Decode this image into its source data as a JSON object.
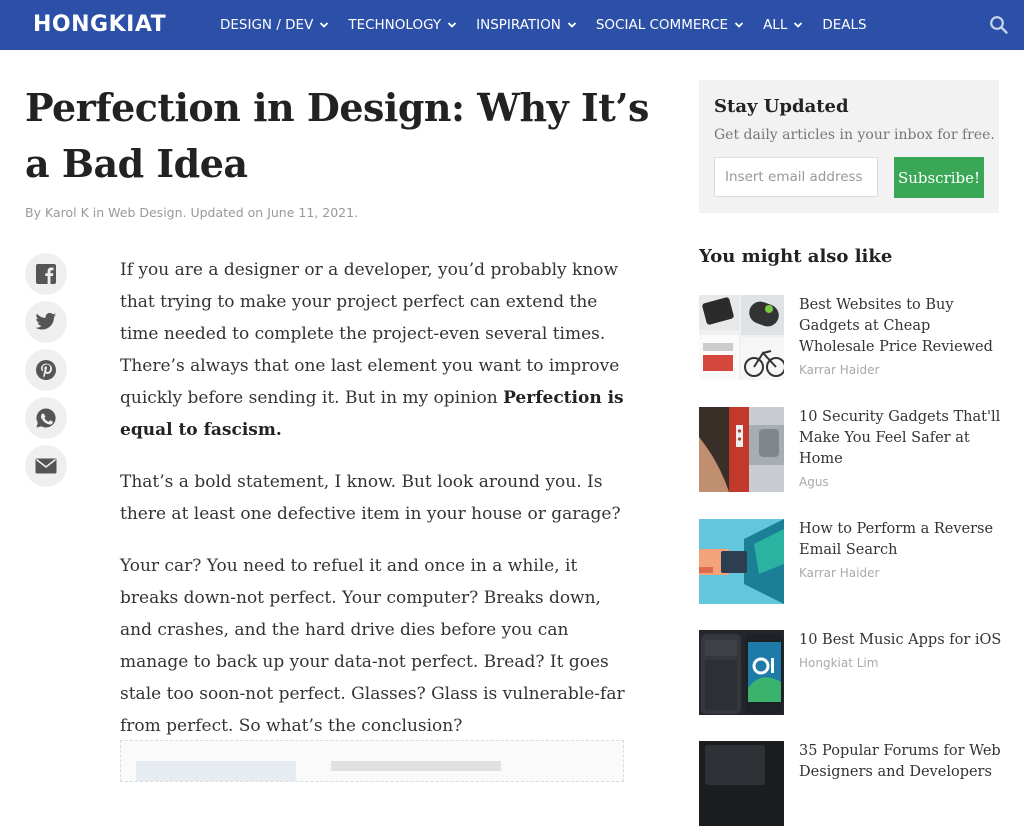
{
  "nav": {
    "logo": "HONGKIAT",
    "items": [
      {
        "label": "DESIGN / DEV",
        "has_dropdown": true
      },
      {
        "label": "TECHNOLOGY",
        "has_dropdown": true
      },
      {
        "label": "INSPIRATION",
        "has_dropdown": true
      },
      {
        "label": "SOCIAL COMMERCE",
        "has_dropdown": true
      },
      {
        "label": "ALL",
        "has_dropdown": true
      },
      {
        "label": "DEALS",
        "has_dropdown": false
      }
    ],
    "search_icon": "search-icon",
    "bg_color": "#2c4fa8"
  },
  "article": {
    "title": "Perfection in Design: Why It’s a Bad Idea",
    "meta": {
      "by": "By",
      "author": "Karol K",
      "in": "in",
      "category": "Web Design",
      "updated": ". Updated on June 11, 2021."
    },
    "share_icons": [
      "facebook-icon",
      "twitter-icon",
      "pinterest-icon",
      "whatsapp-icon",
      "email-icon"
    ],
    "paragraphs": [
      {
        "text": "If you are a designer or a developer, you’d probably know that trying to make your project perfect can extend the time needed to complete the project-even several times. There’s always that one last element you want to improve quickly before sending it. But in my opinion ",
        "bold": "Perfection is equal to fascism."
      },
      {
        "text": "That’s a bold statement, I know. But look around you. Is there at least one defective item in your house or garage?",
        "bold": ""
      },
      {
        "text": "Your car? You need to refuel it and once in a while, it breaks down-not perfect. Your computer? Breaks down, and crashes, and the hard drive dies before you can manage to back up your data-not perfect. Bread? It goes stale too soon-not perfect. Glasses? Glass is vulnerable-far from perfect. So what’s the conclusion?",
        "bold": ""
      }
    ]
  },
  "sidebar": {
    "subscribe": {
      "title": "Stay Updated",
      "description": "Get daily articles in your inbox for free.",
      "placeholder": "Insert email address",
      "button": "Subscribe!",
      "button_color": "#3aa757"
    },
    "related_title": "You might also like",
    "related": [
      {
        "title": "Best Websites to Buy Gadgets at Cheap Wholesale Price Reviewed",
        "author": "Karrar Haider"
      },
      {
        "title": "10 Security Gadgets That'll Make You Feel Safer at Home",
        "author": "Agus"
      },
      {
        "title": "How to Perform a Reverse Email Search",
        "author": "Karrar Haider"
      },
      {
        "title": "10 Best Music Apps for iOS",
        "author": "Hongkiat Lim"
      },
      {
        "title": "35 Popular Forums for Web Designers and Developers",
        "author": ""
      }
    ]
  }
}
